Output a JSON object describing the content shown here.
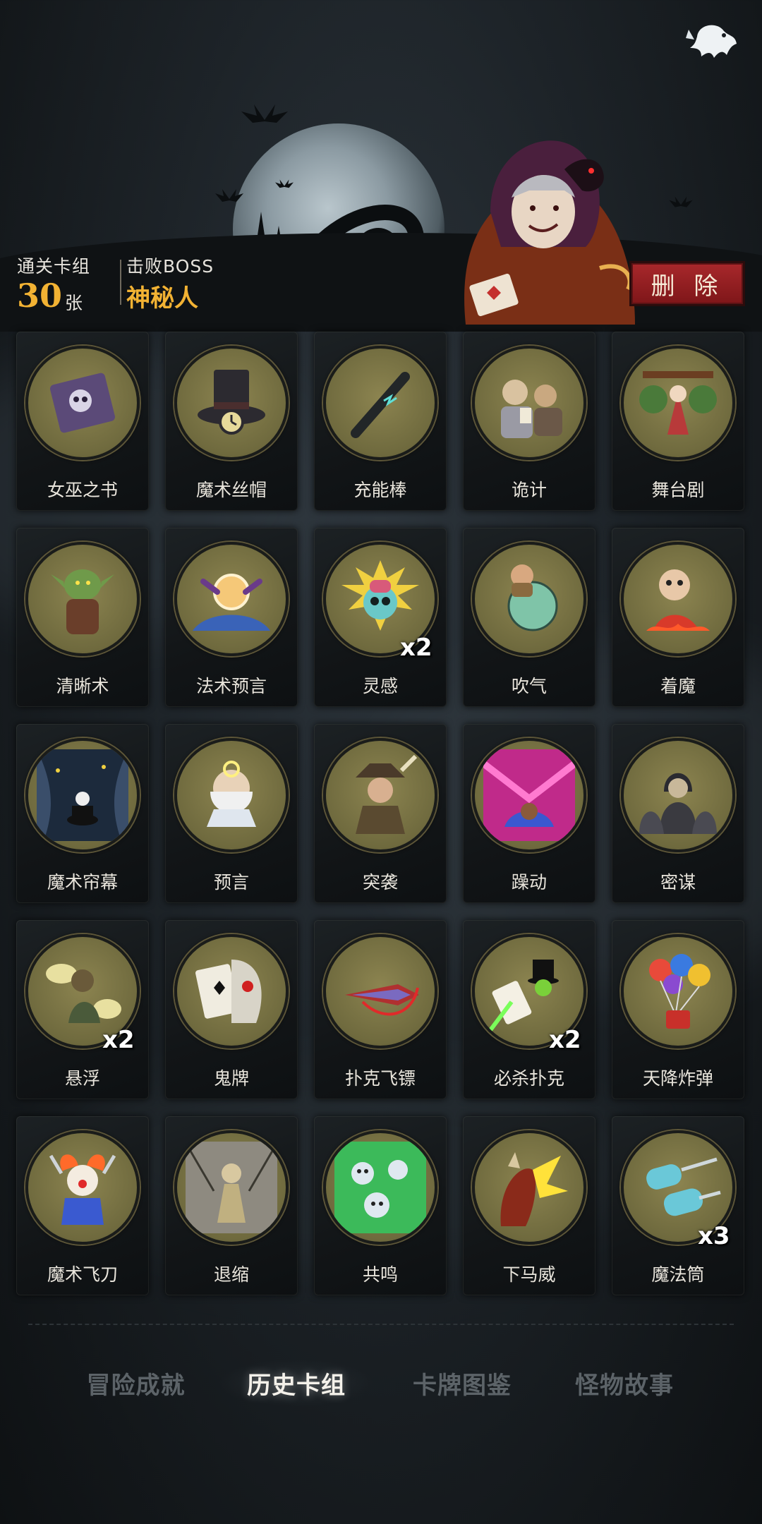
{
  "header": {
    "clear_label": "通关卡组",
    "clear_count": "30",
    "clear_unit": "张",
    "boss_label": "击败BOSS",
    "boss_name": "神秘人",
    "delete_label": "删 除"
  },
  "cards": [
    {
      "name": "女巫之书",
      "icon": "skull-book-icon"
    },
    {
      "name": "魔术丝帽",
      "icon": "top-hat-clock-icon"
    },
    {
      "name": "充能棒",
      "icon": "wand-icon"
    },
    {
      "name": "诡计",
      "icon": "card-players-icon"
    },
    {
      "name": "舞台剧",
      "icon": "stage-play-icon"
    },
    {
      "name": "清晰术",
      "icon": "goblin-icon"
    },
    {
      "name": "法术预言",
      "icon": "crystal-ball-hands-icon"
    },
    {
      "name": "灵感",
      "icon": "skull-brain-icon",
      "multiplier": "x2"
    },
    {
      "name": "吹气",
      "icon": "bubble-man-icon"
    },
    {
      "name": "着魔",
      "icon": "possessed-boy-icon"
    },
    {
      "name": "魔术帘幕",
      "icon": "curtain-hat-icon"
    },
    {
      "name": "预言",
      "icon": "old-prophet-icon"
    },
    {
      "name": "突袭",
      "icon": "ambush-icon"
    },
    {
      "name": "躁动",
      "icon": "frenzy-icon"
    },
    {
      "name": "密谋",
      "icon": "hooded-plotters-icon"
    },
    {
      "name": "悬浮",
      "icon": "levitate-icon",
      "multiplier": "x2"
    },
    {
      "name": "鬼牌",
      "icon": "joker-skull-icon"
    },
    {
      "name": "扑克飞镖",
      "icon": "card-dart-icon"
    },
    {
      "name": "必杀扑克",
      "icon": "magician-cards-icon",
      "multiplier": "x2"
    },
    {
      "name": "天降炸弹",
      "icon": "balloon-bomb-icon"
    },
    {
      "name": "魔术飞刀",
      "icon": "clown-knives-icon"
    },
    {
      "name": "退缩",
      "icon": "retreat-icon"
    },
    {
      "name": "共鸣",
      "icon": "green-skulls-icon"
    },
    {
      "name": "下马威",
      "icon": "demon-strike-icon"
    },
    {
      "name": "魔法筒",
      "icon": "magic-cylinders-icon",
      "multiplier": "x3"
    }
  ],
  "tabs": [
    {
      "label": "冒险成就",
      "active": false
    },
    {
      "label": "历史卡组",
      "active": true
    },
    {
      "label": "卡牌图鉴",
      "active": false
    },
    {
      "label": "怪物故事",
      "active": false
    }
  ],
  "colors": {
    "accent_gold": "#f2b233",
    "delete_red": "#a8282b",
    "disc_olive": "#6f6a3e"
  }
}
